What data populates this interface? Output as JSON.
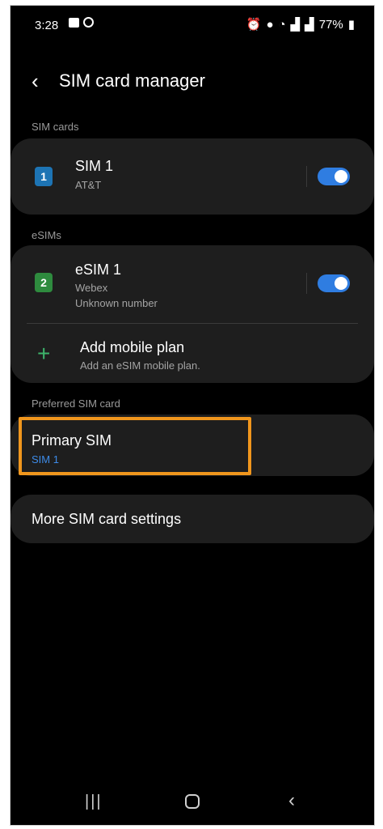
{
  "status_bar": {
    "time": "3:28",
    "battery": "77%"
  },
  "header": {
    "title": "SIM card manager"
  },
  "sim_cards": {
    "section_label": "SIM cards",
    "sim1": {
      "icon_number": "1",
      "name": "SIM 1",
      "carrier": "AT&T",
      "enabled": true
    }
  },
  "esims": {
    "section_label": "eSIMs",
    "esim1": {
      "icon_number": "2",
      "name": "eSIM 1",
      "carrier": "Webex",
      "number": "Unknown number",
      "enabled": true
    },
    "add_plan": {
      "label": "Add mobile plan",
      "description": "Add an eSIM mobile plan."
    }
  },
  "preferred": {
    "section_label": "Preferred SIM card",
    "primary_label": "Primary SIM",
    "primary_value": "SIM 1"
  },
  "more_settings": {
    "label": "More SIM card settings"
  },
  "colors": {
    "accent": "#2f7de1",
    "highlight": "#f0961d",
    "sim1_icon": "#1d74b4",
    "esim_icon": "#2e8b3e",
    "plus": "#3db36b"
  }
}
